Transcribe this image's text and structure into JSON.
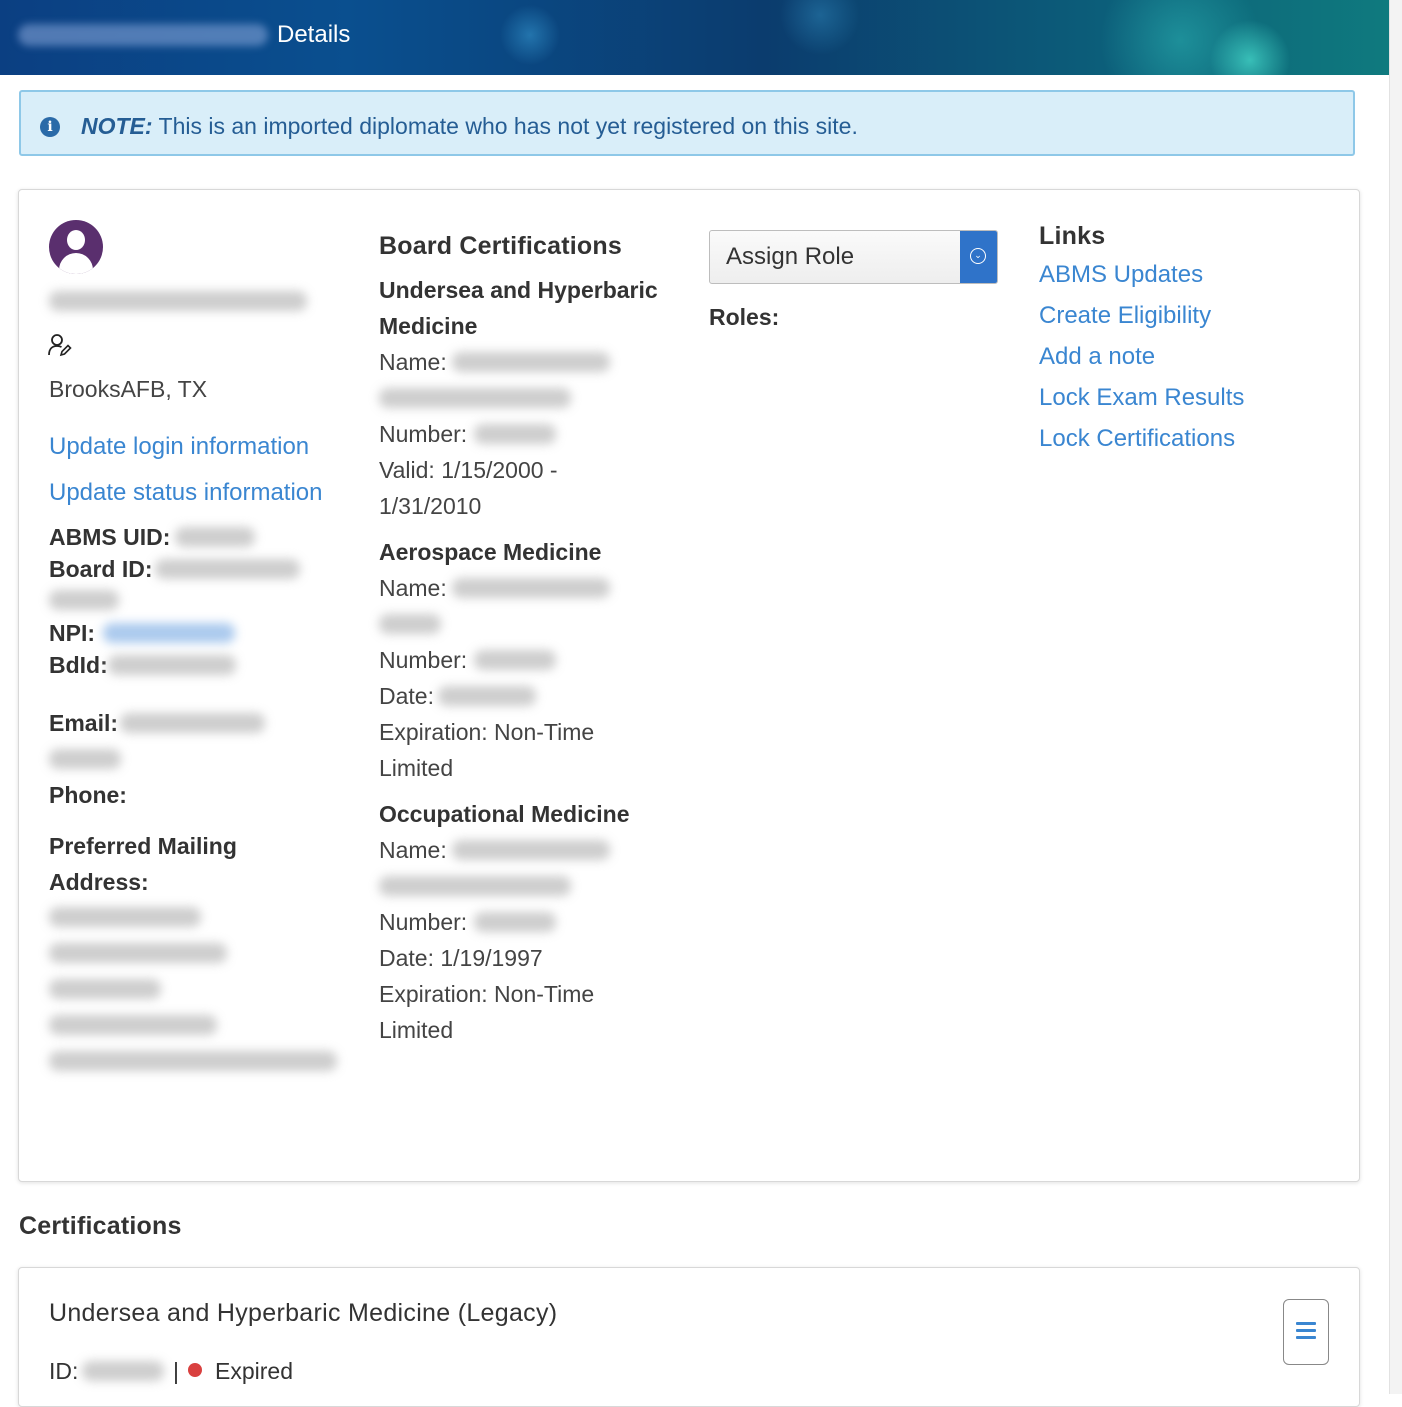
{
  "header": {
    "title": "Details"
  },
  "note": {
    "label": "NOTE:",
    "text": " This is an imported diplomate who has not yet registered on this site."
  },
  "profile": {
    "location": "BrooksAFB, TX",
    "update_login": "Update login information",
    "update_status": "Update status information",
    "abms_uid_label": "ABMS UID:",
    "board_id_label": "Board ID:",
    "npi_label": "NPI:",
    "bdid_label": "BdId:",
    "email_label": "Email:",
    "phone_label": "Phone:",
    "mailing_label_1": "Preferred Mailing",
    "mailing_label_2": "Address:"
  },
  "board_certifications": {
    "heading": "Board Certifications",
    "items": [
      {
        "title_1": "Undersea and Hyperbaric",
        "title_2": "Medicine",
        "name_label": "Name:",
        "number_label": "Number:",
        "valid_1": "Valid: 1/15/2000 -",
        "valid_2": "1/31/2010"
      },
      {
        "title_1": "Aerospace Medicine",
        "name_label": "Name:",
        "number_label": "Number:",
        "date_label": "Date:",
        "expiration_1": "Expiration: Non-Time",
        "expiration_2": "Limited"
      },
      {
        "title_1": "Occupational Medicine",
        "name_label": "Name:",
        "number_label": "Number:",
        "date": "Date: 1/19/1997",
        "expiration_1": "Expiration: Non-Time",
        "expiration_2": "Limited"
      }
    ]
  },
  "roles": {
    "assign_role": "Assign Role",
    "roles_label": "Roles:"
  },
  "links": {
    "heading": "Links",
    "items": [
      "ABMS Updates",
      "Create Eligibility",
      "Add a note",
      "Lock Exam Results",
      "Lock Certifications"
    ]
  },
  "certifications": {
    "heading": "Certifications",
    "card_title": "Undersea and Hyperbaric Medicine (Legacy)",
    "id_label": "ID:",
    "separator": "|",
    "status": "Expired",
    "status_color": "#d9403f"
  },
  "colors": {
    "link": "#3a86d1",
    "accent": "#2f73c9",
    "note_bg": "#d9eef9"
  }
}
